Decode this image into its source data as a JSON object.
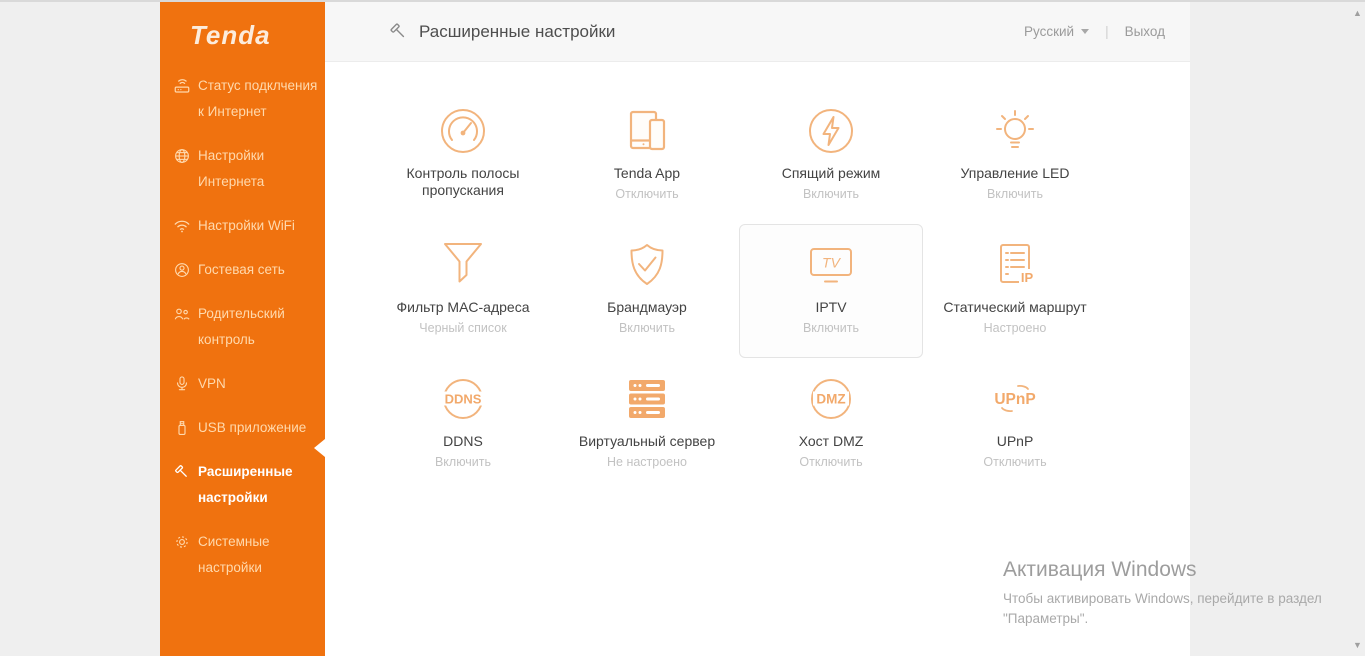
{
  "app": {
    "logo": "Tenda"
  },
  "sidebar": {
    "items": [
      {
        "label": "Статус подклчения к Интернет",
        "icon": "router-icon",
        "selected": false
      },
      {
        "label": "Настройки Интернета",
        "icon": "globe-icon",
        "selected": false
      },
      {
        "label": "Настройки WiFi",
        "icon": "wifi-icon",
        "selected": false
      },
      {
        "label": "Гостевая сеть",
        "icon": "guest-network-icon",
        "selected": false
      },
      {
        "label": "Родительский контроль",
        "icon": "parental-control-icon",
        "selected": false
      },
      {
        "label": "VPN",
        "icon": "vpn-icon",
        "selected": false
      },
      {
        "label": "USB приложение",
        "icon": "usb-icon",
        "selected": false
      },
      {
        "label": "Расширенные настройки",
        "icon": "wrench-icon",
        "selected": true
      },
      {
        "label": "Системные настройки",
        "icon": "gear-icon",
        "selected": false
      }
    ]
  },
  "header": {
    "title": "Расширенные настройки",
    "language": "Русский",
    "separator": "|",
    "logout": "Выход"
  },
  "tiles": [
    {
      "title": "Контроль полосы пропускания",
      "status": "",
      "icon": "speedometer-icon",
      "highlighted": false
    },
    {
      "title": "Tenda App",
      "status": "Отключить",
      "icon": "devices-icon",
      "highlighted": false
    },
    {
      "title": "Спящий режим",
      "status": "Включить",
      "icon": "lightning-circle-icon",
      "highlighted": false
    },
    {
      "title": "Управление LED",
      "status": "Включить",
      "icon": "bulb-icon",
      "highlighted": false
    },
    {
      "title": "Фильтр MAC-адреса",
      "status": "Черный список",
      "icon": "funnel-icon",
      "highlighted": false
    },
    {
      "title": "Брандмауэр",
      "status": "Включить",
      "icon": "shield-check-icon",
      "highlighted": false
    },
    {
      "title": "IPTV",
      "status": "Включить",
      "icon": "tv-icon",
      "highlighted": true
    },
    {
      "title": "Статический маршрут",
      "status": "Настроено",
      "icon": "route-list-ip-icon",
      "highlighted": false
    },
    {
      "title": "DDNS",
      "status": "Включить",
      "icon": "ddns-circle-icon",
      "highlighted": false
    },
    {
      "title": "Виртуальный сервер",
      "status": "Не настроено",
      "icon": "server-icon",
      "highlighted": false
    },
    {
      "title": "Хост DMZ",
      "status": "Отключить",
      "icon": "dmz-circle-icon",
      "highlighted": false
    },
    {
      "title": "UPnP",
      "status": "Отключить",
      "icon": "upnp-icon",
      "highlighted": false
    }
  ],
  "icon_labels": {
    "tv": "TV",
    "ip": "IP",
    "ddns": "DDNS",
    "dmz": "DMZ",
    "upnp": "UPnP"
  },
  "watermark": {
    "title": "Активация Windows",
    "body": "Чтобы активировать Windows, перейдите в раздел \"Параметры\"."
  },
  "colors": {
    "sidebar_orange": "#f0720f",
    "sidebar_text": "#ffd9ad",
    "selected_text": "#ffffff",
    "tile_icon_orange": "#f2b47d",
    "tile_icon_fill_orange": "#f2a96b",
    "tile_title": "#434343",
    "tile_status": "#c2c2c2",
    "header_bg": "#f7f7f7",
    "header_title": "#4e4e4e",
    "page_bg": "#efefef"
  }
}
